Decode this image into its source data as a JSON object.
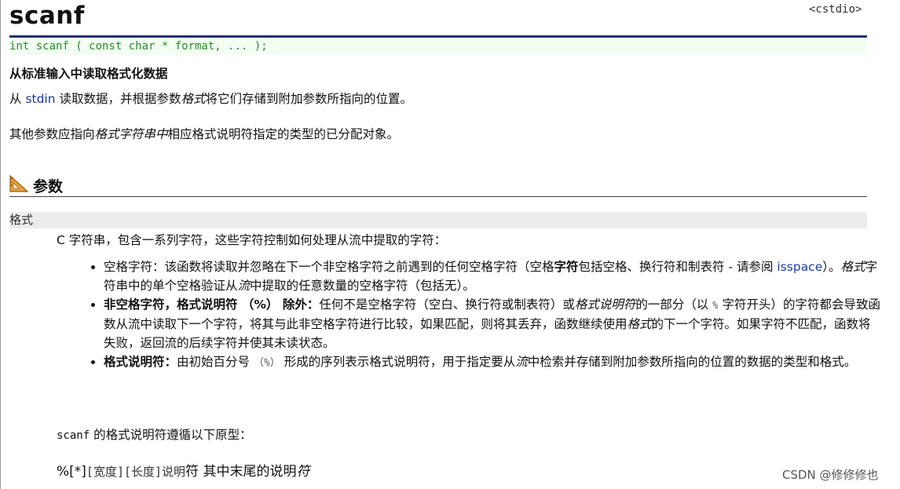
{
  "title": "scanf",
  "header": "<cstdio>",
  "prototype": "int scanf ( const char * format, ... );",
  "summary": "从标准输入中读取格式化数据",
  "p1": {
    "a": "从 ",
    "stdin": "stdin",
    "b": " 读取数据，并根据参数",
    "format": "格式",
    "c": "将它们存储到附加参数所指向的位置。"
  },
  "p2": {
    "a": "其他参数应指向",
    "fmtstr": "格式字符串中",
    "b": "相应格式说明符指定的类型的已分配对象。"
  },
  "section": {
    "icon": "ruler-triangle-icon",
    "label": "参数"
  },
  "param": {
    "name": "格式",
    "desc": "C 字符串，包含一系列字符，这些字符控制如何处理从流中提取的字符："
  },
  "bullets": {
    "b1": {
      "a": "空格字符：该函数将读取并忽略在下一个非空格字符之前遇到的任何空格字符（空格",
      "bold": "字符",
      "b": "包括空格、换行符和制表符 - 请参阅 ",
      "isspace": "isspace",
      "c": "）。",
      "fmt": "格式",
      "d": "字符串中的单个空格验证从",
      "stream": "流",
      "e": "中提取的任意数量的空格字符（包括无）。"
    },
    "b2": {
      "label": "非空格字符，格式说明符 （%） 除外：",
      "a": "任何不是空格字符（空白、换行符或制表符）或",
      "spec": "格式说明符",
      "b": "的一部分（以 ",
      "pct": "%",
      "c": " 字符开头）的字符都会导致函数从流中读取下一个字符，将其与此非空格字符进行比较，如果匹配，则将其丢弃，函数继续使用",
      "fmt": "格式",
      "d": "的下一个字符。如果字符不匹配，函数将失败，返回流的后续字符并使其未读状态。"
    },
    "b3": {
      "label": "格式说明符：",
      "a": "由初始百分号 ",
      "pct": "（%）",
      "b": " 形成的序列表示格式说明符，用于指定要从",
      "stream": "流",
      "c": "中检索并存储到附加参数所指向的位置的数据的类型和格式。"
    }
  },
  "proto_intro": {
    "code": "scanf",
    "text": " 的格式说明符遵循以下原型："
  },
  "format_line": {
    "pct": "%[*]",
    "width": "[宽度]",
    "length": "[长度]",
    "spec": "说明",
    "a": "符 其中末尾的说明",
    "b": "符"
  },
  "watermark": "CSDN @修修修也"
}
